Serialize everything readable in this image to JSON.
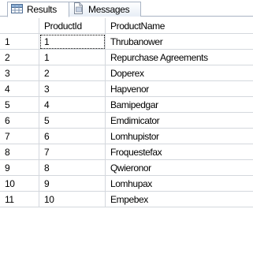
{
  "tabs": [
    {
      "label": "Results",
      "icon": "grid-icon",
      "active": true
    },
    {
      "label": "Messages",
      "icon": "document-icon",
      "active": false
    }
  ],
  "columns": [
    "",
    "ProductId",
    "ProductName"
  ],
  "rows": [
    {
      "num": "1",
      "id": "1",
      "name": "Thrubanower"
    },
    {
      "num": "2",
      "id": "1",
      "name": "Repurchase Agreements"
    },
    {
      "num": "3",
      "id": "2",
      "name": "Doperex"
    },
    {
      "num": "4",
      "id": "3",
      "name": "Hapvenor"
    },
    {
      "num": "5",
      "id": "4",
      "name": "Bamipedgar"
    },
    {
      "num": "6",
      "id": "5",
      "name": "Emdimicator"
    },
    {
      "num": "7",
      "id": "6",
      "name": "Lomhupistor"
    },
    {
      "num": "8",
      "id": "7",
      "name": "Froquestefax"
    },
    {
      "num": "9",
      "id": "8",
      "name": "Qwieronor"
    },
    {
      "num": "10",
      "id": "9",
      "name": "Lomhupax"
    },
    {
      "num": "11",
      "id": "10",
      "name": "Empebex"
    }
  ],
  "colors": {
    "border": "#a9b4c4",
    "gridline": "#d4d8dd"
  }
}
